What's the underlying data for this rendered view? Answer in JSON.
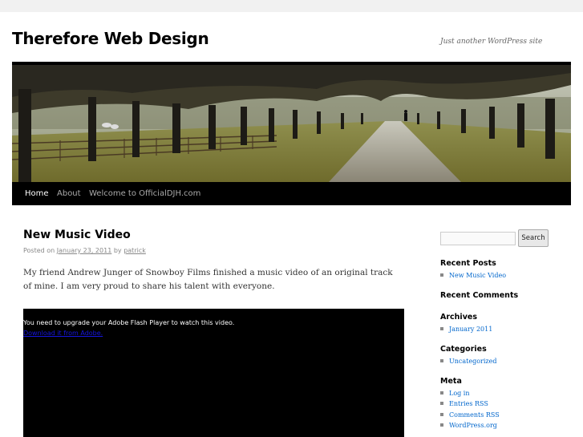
{
  "site": {
    "title": "Therefore Web Design",
    "description": "Just another WordPress site"
  },
  "header": {
    "image_icon": "header-landscape-image"
  },
  "nav": {
    "items": [
      {
        "label": "Home",
        "current": true
      },
      {
        "label": "About",
        "current": false
      },
      {
        "label": "Welcome to OfficialDJH.com",
        "current": false
      }
    ]
  },
  "post": {
    "title": "New Music Video",
    "posted_on": "Posted on",
    "date": "January 23, 2011",
    "by": "by",
    "author": "patrick",
    "content": "My friend Andrew Junger of Snowboy Films finished a music video of an original track of mine. I am very proud to share his talent with everyone.",
    "video": {
      "message": "You need to upgrade your Adobe Flash Player to watch this video.",
      "link": "Download it from Adobe."
    }
  },
  "sidebar": {
    "search": {
      "value": "",
      "button": "Search"
    },
    "recent_posts": {
      "title": "Recent Posts",
      "items": [
        "New Music Video"
      ]
    },
    "recent_comments": {
      "title": "Recent Comments"
    },
    "archives": {
      "title": "Archives",
      "items": [
        "January 2011"
      ]
    },
    "categories": {
      "title": "Categories",
      "items": [
        "Uncategorized"
      ]
    },
    "meta": {
      "title": "Meta",
      "items": [
        "Log in",
        "Entries RSS",
        "Comments RSS",
        "WordPress.org"
      ]
    }
  },
  "colors": {
    "page_bg": "#f1f1f1",
    "nav_bg": "#000000",
    "link": "#0066cc",
    "text": "#333333"
  }
}
